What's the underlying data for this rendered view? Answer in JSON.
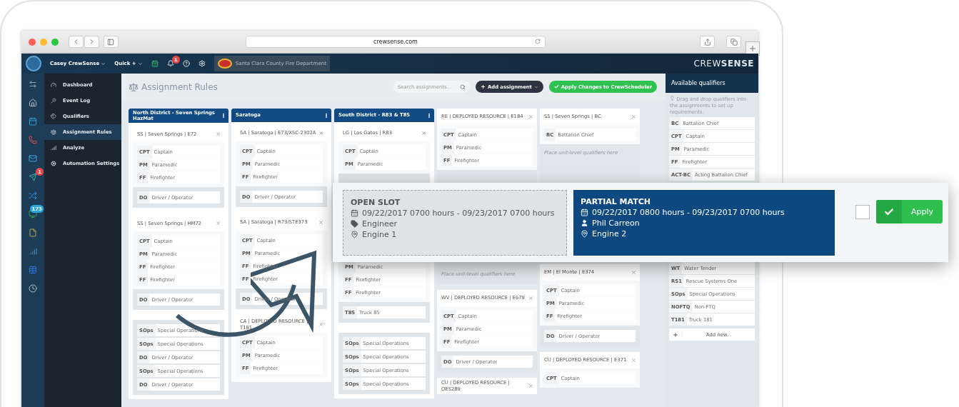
{
  "browser": {
    "url": "crewsense.com"
  },
  "topbar": {
    "user_menu": "Casey CrewSense",
    "quick_menu": "Quick +",
    "notification_count": "1",
    "organization": "Santa Clara County Fire Department",
    "brand": "CREW**SENSE**"
  },
  "rail": [
    {
      "kind": "swap"
    },
    {
      "kind": "home"
    },
    {
      "kind": "calendar"
    },
    {
      "kind": "phone"
    },
    {
      "kind": "mail"
    },
    {
      "kind": "send",
      "badge": "1"
    },
    {
      "kind": "shuffle"
    },
    {
      "kind": "monitor",
      "badge": "173"
    },
    {
      "kind": "file"
    },
    {
      "kind": "chart"
    },
    {
      "kind": "table"
    },
    {
      "kind": "clock"
    }
  ],
  "nav": [
    {
      "label": "Dashboard",
      "kind": "gauge",
      "selected": false
    },
    {
      "label": "Event Log",
      "kind": "wand",
      "selected": false
    },
    {
      "label": "Qualifiers",
      "kind": "tags",
      "selected": false
    },
    {
      "label": "Assignment Rules",
      "kind": "scale",
      "selected": true
    },
    {
      "label": "Analyze",
      "kind": "chart",
      "selected": false
    },
    {
      "label": "Automation Settings",
      "kind": "cogs",
      "selected": false
    }
  ],
  "page": {
    "title": "Assignment Rules",
    "search": {
      "placeholder": "Search assignments..."
    },
    "add_button": "Add assignment",
    "apply_button": "Apply Changes to CrewScheduler"
  },
  "columns": [
    {
      "title": "North District - Seven Springs HazMat",
      "cards": [
        {
          "title": "SS | Seven Springs | E72",
          "qualifiers": [
            {
              "code": "CPT",
              "name": "Captain"
            },
            {
              "code": "PM",
              "name": "Paramedic"
            },
            {
              "code": "FF",
              "name": "Firefighter"
            }
          ],
          "unit": [
            {
              "code": "DO",
              "name": "Driver / Operator"
            }
          ]
        },
        {
          "title": "SS | Seven Springs | HM72",
          "qualifiers": [
            {
              "code": "CPT",
              "name": "Captain"
            },
            {
              "code": "PM",
              "name": "Paramedic"
            },
            {
              "code": "FF",
              "name": "Firefighter"
            },
            {
              "code": "FF",
              "name": "Firefighter"
            }
          ],
          "unit": [
            {
              "code": "DO",
              "name": "Driver / Operator"
            }
          ]
        },
        {
          "unit": [
            {
              "code": "SOps",
              "name": "Special Operations"
            },
            {
              "code": "SOps",
              "name": "Special Operations"
            },
            {
              "code": "DO",
              "name": "Driver / Operator"
            },
            {
              "code": "SOps",
              "name": "Special Operations"
            },
            {
              "code": "DO",
              "name": "Driver / Operator"
            }
          ]
        }
      ]
    },
    {
      "title": "Saratoga",
      "cards": [
        {
          "title": "SA | Saratoga | E73/XSC-2302A",
          "qualifiers": [
            {
              "code": "CPT",
              "name": "Captain"
            },
            {
              "code": "PM",
              "name": "Paramedic"
            },
            {
              "code": "FF",
              "name": "Firefighter"
            }
          ],
          "unit": [
            {
              "code": "DO",
              "name": "Driver / Operator"
            }
          ]
        },
        {
          "title": "SA | Saratoga | R73/STE373",
          "qualifiers": [
            {
              "code": "CPT",
              "name": "Captain"
            },
            {
              "code": "PM",
              "name": "Paramedic"
            },
            {
              "code": "FF",
              "name": "Firefighter"
            },
            {
              "code": "FF",
              "name": "Firefighter"
            }
          ],
          "unit": [
            {
              "code": "DO",
              "name": "Driver / Operator"
            }
          ]
        },
        {
          "title": "CA | DEPLOYED RESOURCE | T181",
          "qualifiers": [
            {
              "code": "CPT",
              "name": "Captain"
            },
            {
              "code": "PM",
              "name": "Paramedic"
            },
            {
              "code": "FF",
              "name": "Firefighter"
            }
          ]
        }
      ]
    },
    {
      "title": "South District - R83 & T85",
      "cards": [
        {
          "title": "LG | Los Gatos | R83",
          "qualifiers": [
            {
              "code": "CPT",
              "name": "Captain"
            },
            {
              "code": "PM",
              "name": "Paramedic"
            }
          ]
        },
        {
          "qualifiers": [
            {
              "code": "PM",
              "name": "Paramedic"
            },
            {
              "code": "FF",
              "name": "Firefighter"
            },
            {
              "code": "FF",
              "name": "Firefighter"
            }
          ],
          "unit": [
            {
              "code": "T85",
              "name": "Truck 85"
            }
          ]
        },
        {
          "unit": [
            {
              "code": "SOps",
              "name": "Special Operations"
            },
            {
              "code": "SOps",
              "name": "Special Operations"
            },
            {
              "code": "SOps",
              "name": "Special Operations"
            },
            {
              "code": "SOps",
              "name": "Special Operations"
            }
          ]
        }
      ]
    },
    {
      "cards": [
        {
          "title": "RE | DEPLOYED RESOURCE | E184",
          "qualifiers": [
            {
              "code": "CPT",
              "name": "Captain"
            },
            {
              "code": "PM",
              "name": "Paramedic"
            },
            {
              "code": "FF",
              "name": "Firefighter"
            }
          ],
          "unit_hint": "Place unit-level qualifiers here"
        },
        {
          "title": "WV | DEPLOYED RESOURCE | E679",
          "qualifiers": [
            {
              "code": "CPT",
              "name": "Captain"
            },
            {
              "code": "PM",
              "name": "Paramedic"
            },
            {
              "code": "FF",
              "name": "Firefighter"
            }
          ],
          "unit": [
            {
              "code": "DO",
              "name": "Driver / Operator"
            }
          ]
        },
        {
          "title": "CU | DEPLOYED RESOURCE | OES289"
        }
      ]
    },
    {
      "cards": [
        {
          "title": "SS | Seven Springs | BC",
          "qualifiers": [
            {
              "code": "BC",
              "name": "Battalion Chief"
            }
          ],
          "unit_hint": "Place unit-level qualifiers here"
        },
        {
          "title": "EM | El Monte | E374",
          "qualifiers": [
            {
              "code": "CPT",
              "name": "Captain"
            },
            {
              "code": "PM",
              "name": "Paramedic"
            },
            {
              "code": "FF",
              "name": "Firefighter"
            }
          ],
          "unit": [
            {
              "code": "DO",
              "name": "Driver / Operator"
            }
          ]
        },
        {
          "title": "CU | DEPLOYED RESOURCE | E371",
          "qualifiers": [
            {
              "code": "CPT",
              "name": "Captain"
            }
          ]
        }
      ]
    }
  ],
  "panel": {
    "title": "Available qualifiers",
    "hint": "Drag and drop qualifiers into the assignments to set up requirements.",
    "groups": [
      [
        {
          "code": "BC",
          "name": "Battalion Chief"
        },
        {
          "code": "CPT",
          "name": "Captain"
        },
        {
          "code": "PM",
          "name": "Paramedic"
        },
        {
          "code": "FF",
          "name": "Firefighter"
        },
        {
          "code": "ACT-BC",
          "name": "Acting Battalion Chief"
        }
      ],
      [
        {
          "code": "WT",
          "name": "Water Tender"
        },
        {
          "code": "RS1",
          "name": "Rescue Systems One"
        },
        {
          "code": "SOps",
          "name": "Special Operations"
        },
        {
          "code": "NOFTQ",
          "name": "Non-FTQ"
        },
        {
          "code": "T181",
          "name": "Truck 181"
        }
      ]
    ],
    "add_label": "Add new..."
  },
  "callout": {
    "open_slot": {
      "title": "OPEN SLOT",
      "time": "09/22/2017 0700 hours - 09/23/2017 0700 hours",
      "qualifier": "Engineer",
      "location": "Engine 1"
    },
    "match": {
      "title": "PARTIAL MATCH",
      "time": "09/22/2017 0800 hours - 09/23/2017 0700 hours",
      "person": "Phil Carreon",
      "location": "Engine 2"
    },
    "checked": false,
    "apply_label": "Apply"
  }
}
